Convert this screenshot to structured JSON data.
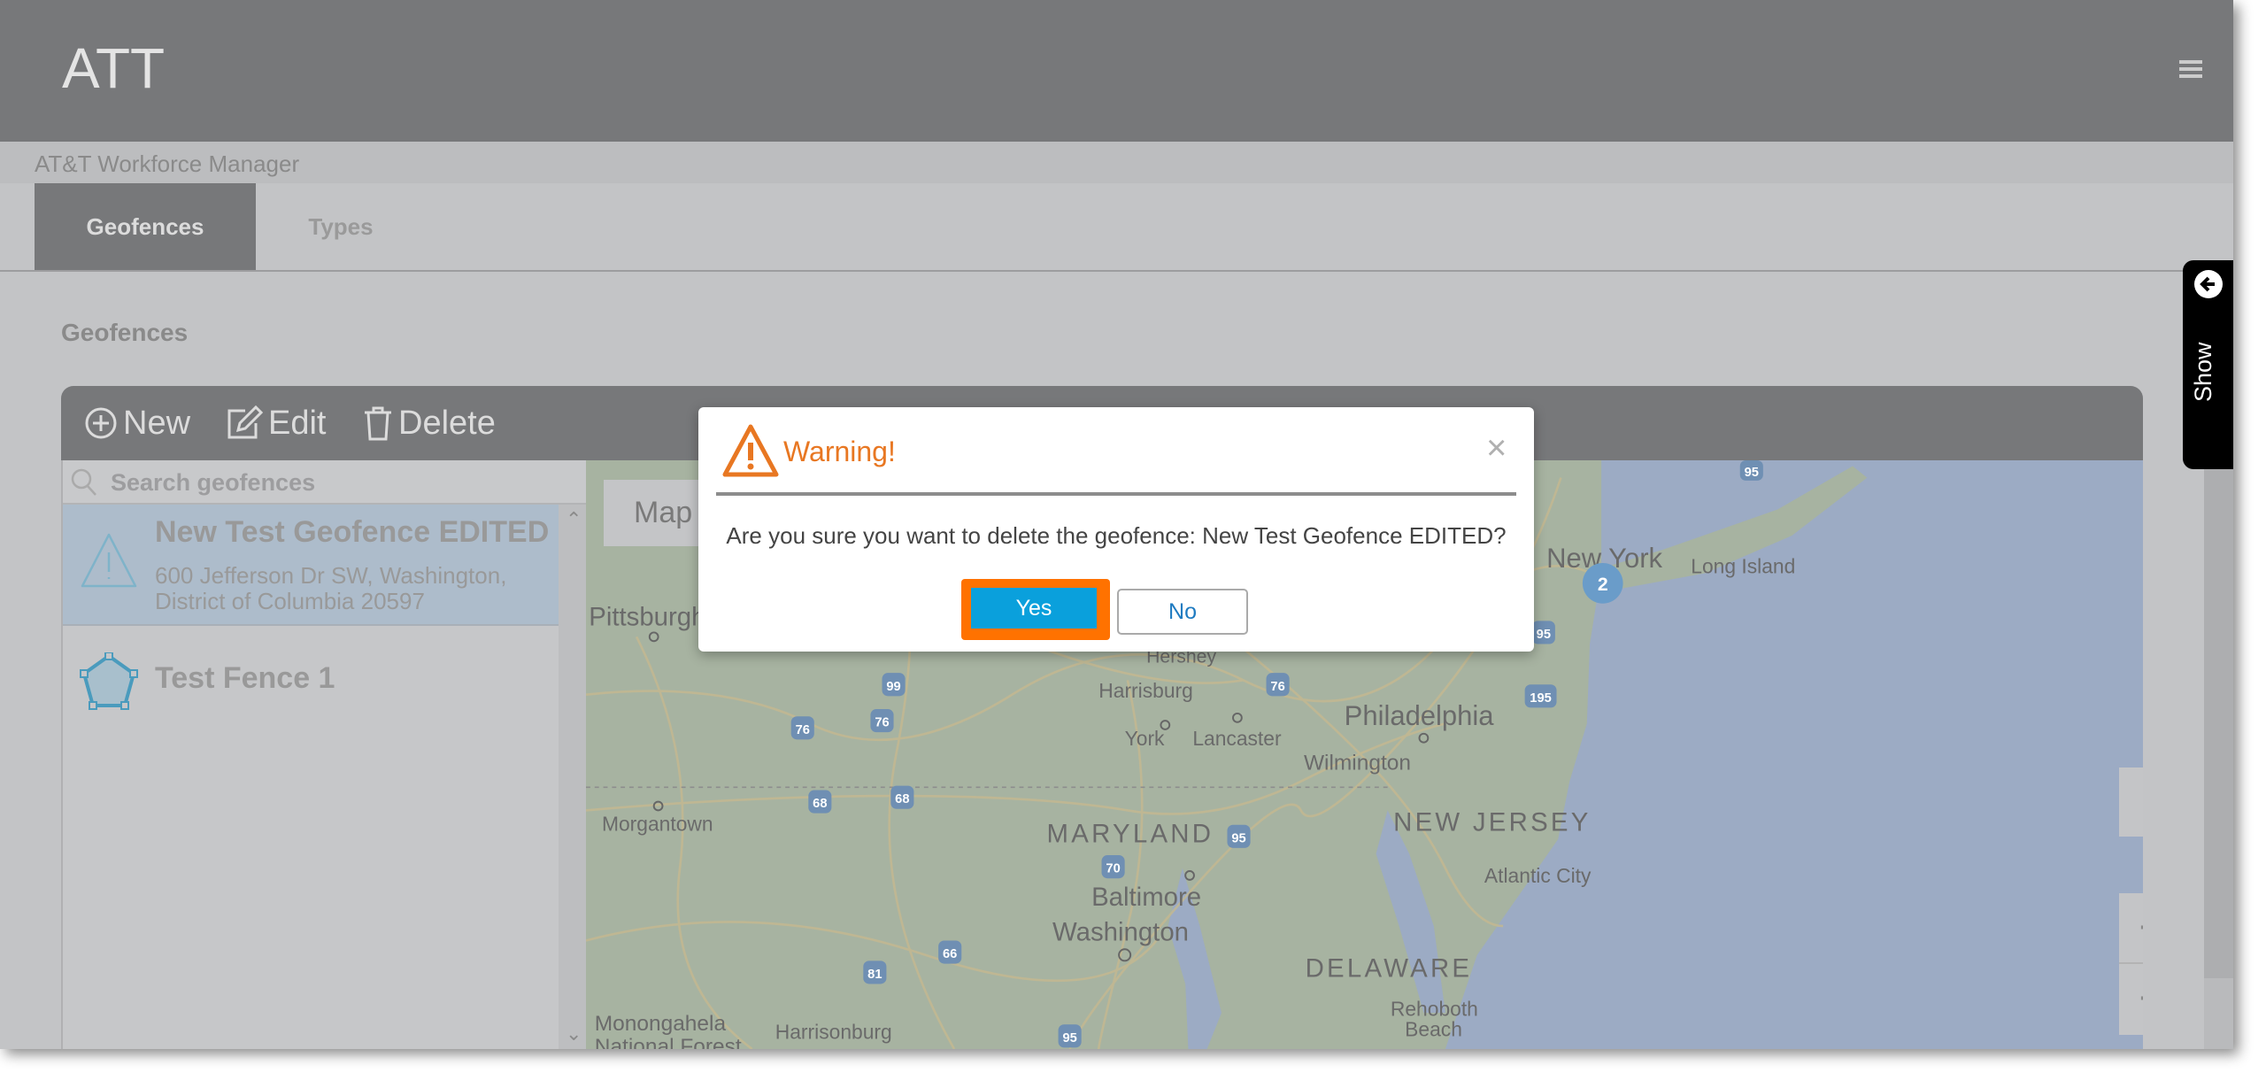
{
  "header": {
    "title": "ATT",
    "menu_icon": "hamburger-icon"
  },
  "subtitle": "AT&T Workforce Manager",
  "tabs": [
    {
      "label": "Geofences",
      "active": true
    },
    {
      "label": "Types",
      "active": false
    }
  ],
  "section_title": "Geofences",
  "toolbar": {
    "new_label": "New",
    "edit_label": "Edit",
    "delete_label": "Delete"
  },
  "search": {
    "placeholder": "Search geofences",
    "value": ""
  },
  "geofences": [
    {
      "name": "New Test Geofence EDITED",
      "address_line1": "600 Jefferson Dr SW, Washington,",
      "address_line2": "District of Columbia 20597",
      "icon": "warning-triangle-icon",
      "selected": true
    },
    {
      "name": "Test Fence 1",
      "icon": "polygon-icon",
      "selected": false
    }
  ],
  "map": {
    "type_button": "Map",
    "cluster_count": "2",
    "labels": {
      "pittsburgh": "Pittsburgh",
      "new_york": "New York",
      "long_island": "Long Island",
      "hershey": "Hershey",
      "harrisburg": "Harrisburg",
      "york": "York",
      "lancaster": "Lancaster",
      "philadelphia": "Philadelphia",
      "wilmington": "Wilmington",
      "new_jersey": "NEW JERSEY",
      "maryland": "MARYLAND",
      "atlantic_city": "Atlantic City",
      "baltimore": "Baltimore",
      "washington": "Washington",
      "delaware": "DELAWARE",
      "rehoboth1": "Rehoboth",
      "rehoboth2": "Beach",
      "morgantown": "Morgantown",
      "monongahela1": "Monongahela",
      "monongahela2": "National Forest",
      "harrisonburg": "Harrisonburg"
    },
    "highways": [
      "99",
      "76",
      "76",
      "76",
      "68",
      "68",
      "95",
      "95",
      "95",
      "95",
      "70",
      "66",
      "81",
      "195"
    ],
    "zoom_in": "+",
    "zoom_out": "−"
  },
  "side_tab": {
    "label": "Show",
    "icon": "arrow-left-circle-icon"
  },
  "dialog": {
    "title": "Warning!",
    "close": "×",
    "message": "Are you sure you want to delete the geofence: New Test Geofence EDITED?",
    "yes_label": "Yes",
    "no_label": "No",
    "colors": {
      "title": "#e87722",
      "yes": "#0aa0dc",
      "highlight": "#ff7200"
    }
  }
}
